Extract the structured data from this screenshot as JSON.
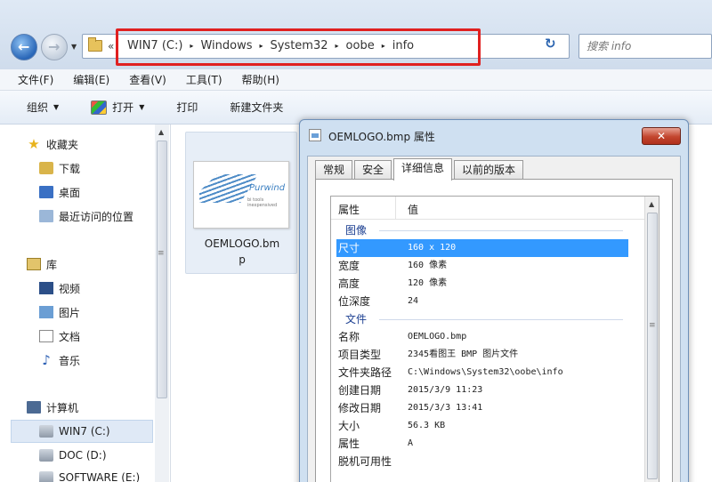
{
  "address_bar": {
    "overflow": "«",
    "breadcrumbs": [
      "WIN7 (C:)",
      "Windows",
      "System32",
      "oobe",
      "info"
    ],
    "separator": "▸",
    "search_placeholder": "搜索 info",
    "highlight_color": "#e02020"
  },
  "menubar": {
    "items": [
      "文件(F)",
      "编辑(E)",
      "查看(V)",
      "工具(T)",
      "帮助(H)"
    ]
  },
  "toolbar": {
    "organize": "组织",
    "open": "打开",
    "print": "打印",
    "new_folder": "新建文件夹"
  },
  "nav_pane": {
    "favorites": "收藏夹",
    "downloads": "下载",
    "desktop": "桌面",
    "recent": "最近访问的位置",
    "libraries": "库",
    "videos": "视频",
    "pictures": "图片",
    "documents": "文档",
    "music": "音乐",
    "computer": "计算机",
    "drive_c": "WIN7 (C:)",
    "drive_d": "DOC (D:)",
    "drive_e": "SOFTWARE (E:)"
  },
  "file": {
    "name_line1": "OEMLOGO.bm",
    "name_line2": "p",
    "thumb_brand": "Purwind",
    "thumb_tag": "bi tools inexpensived"
  },
  "dialog": {
    "title": "OEMLOGO.bmp 属性",
    "close_label": "✕",
    "tabs": [
      "常规",
      "安全",
      "详细信息",
      "以前的版本"
    ],
    "header": {
      "property": "属性",
      "value": "值"
    },
    "image_group": "图像",
    "dimensions": {
      "label": "尺寸",
      "value": "160 x 120"
    },
    "width": {
      "label": "宽度",
      "value": "160 像素"
    },
    "height": {
      "label": "高度",
      "value": "120 像素"
    },
    "bit_depth": {
      "label": "位深度",
      "value": "24"
    },
    "file_group": "文件",
    "name": {
      "label": "名称",
      "value": "OEMLOGO.bmp"
    },
    "item_type": {
      "label": "项目类型",
      "value": "2345看图王 BMP 图片文件"
    },
    "folder_path": {
      "label": "文件夹路径",
      "value": "C:\\Windows\\System32\\oobe\\info"
    },
    "created": {
      "label": "创建日期",
      "value": "2015/3/9 11:23"
    },
    "modified": {
      "label": "修改日期",
      "value": "2015/3/3 13:41"
    },
    "size": {
      "label": "大小",
      "value": "56.3 KB"
    },
    "attributes": {
      "label": "属性",
      "value": "A"
    },
    "offline": {
      "label": "脱机可用性",
      "value": ""
    }
  }
}
